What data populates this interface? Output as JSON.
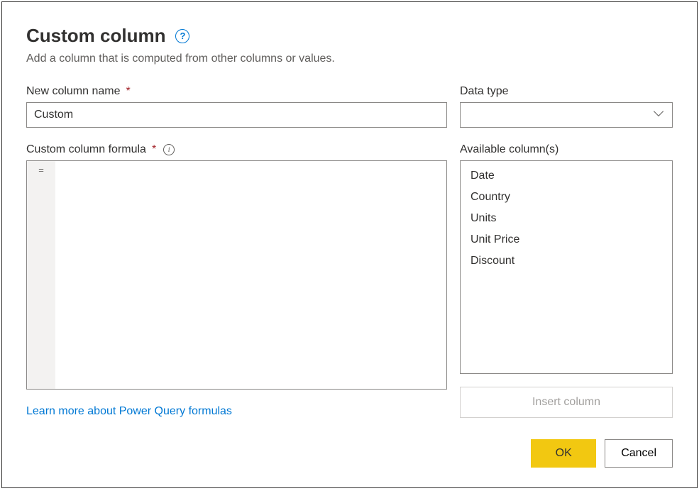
{
  "dialog": {
    "title": "Custom column",
    "subtitle": "Add a column that is computed from other columns or values."
  },
  "columnName": {
    "label": "New column name",
    "value": "Custom"
  },
  "dataType": {
    "label": "Data type",
    "value": ""
  },
  "formula": {
    "label": "Custom column formula",
    "gutter": "=",
    "value": ""
  },
  "available": {
    "label": "Available column(s)",
    "columns": [
      "Date",
      "Country",
      "Units",
      "Unit Price",
      "Discount"
    ]
  },
  "insert": {
    "label": "Insert column"
  },
  "learnLink": "Learn more about Power Query formulas",
  "buttons": {
    "ok": "OK",
    "cancel": "Cancel"
  }
}
